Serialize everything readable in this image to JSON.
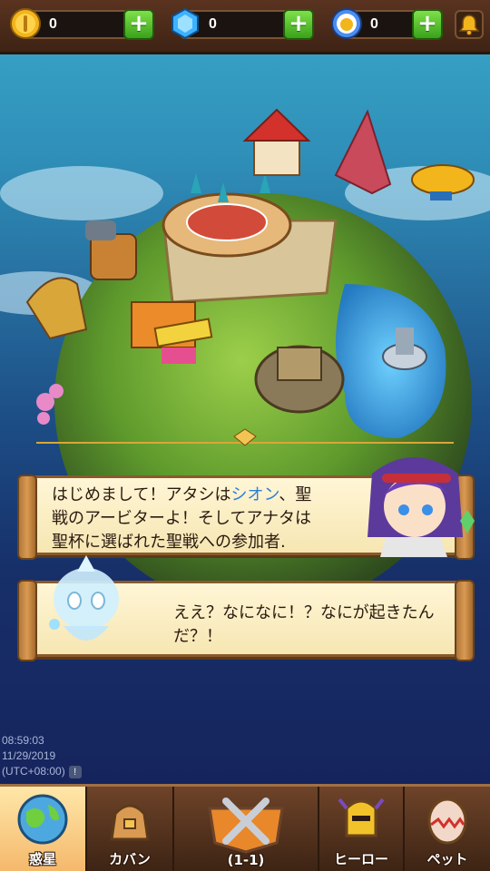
{
  "resources": [
    {
      "name": "gold",
      "value": "0",
      "icon": "gold-coin-icon",
      "color": "#f2b51b"
    },
    {
      "name": "gem",
      "value": "0",
      "icon": "blue-gem-icon",
      "color": "#3db2ff"
    },
    {
      "name": "medal",
      "value": "0",
      "icon": "medal-icon",
      "color": "#4c8ef0"
    }
  ],
  "plus_label": "+",
  "dialogs": {
    "first": {
      "lines": [
        "はじめまして！アタシは",
        "、聖",
        "戦のアービターよ！そしてアナタは",
        "聖杯に選ばれた聖戦への参加者."
      ],
      "highlight": "シオン",
      "speaker_icon": "arbiter-girl-portrait"
    },
    "second": {
      "lines": [
        "ええ？なになに！？なにが起きたん",
        "だ？！"
      ],
      "speaker_icon": "ghost-spirit-portrait"
    }
  },
  "clock": {
    "time": "08:59:03",
    "date": "11/29/2019",
    "timezone": "(UTC+08:00)",
    "warn": "!"
  },
  "nav": {
    "tabs": [
      {
        "label": "惑星",
        "icon": "planet-icon",
        "active": true
      },
      {
        "label": "カバン",
        "icon": "bag-icon",
        "active": false
      },
      {
        "label": "(1-1)",
        "icon": "crossed-swords-icon",
        "active": false
      },
      {
        "label": "ヒーロー",
        "icon": "knight-helmet-icon",
        "active": false
      },
      {
        "label": "ペット",
        "icon": "pet-egg-icon",
        "active": false
      }
    ]
  },
  "colors": {
    "accent_blue": "#2e7fd6",
    "panel_wood": "#8a5a2b",
    "active_tab": "#f4b76a"
  }
}
